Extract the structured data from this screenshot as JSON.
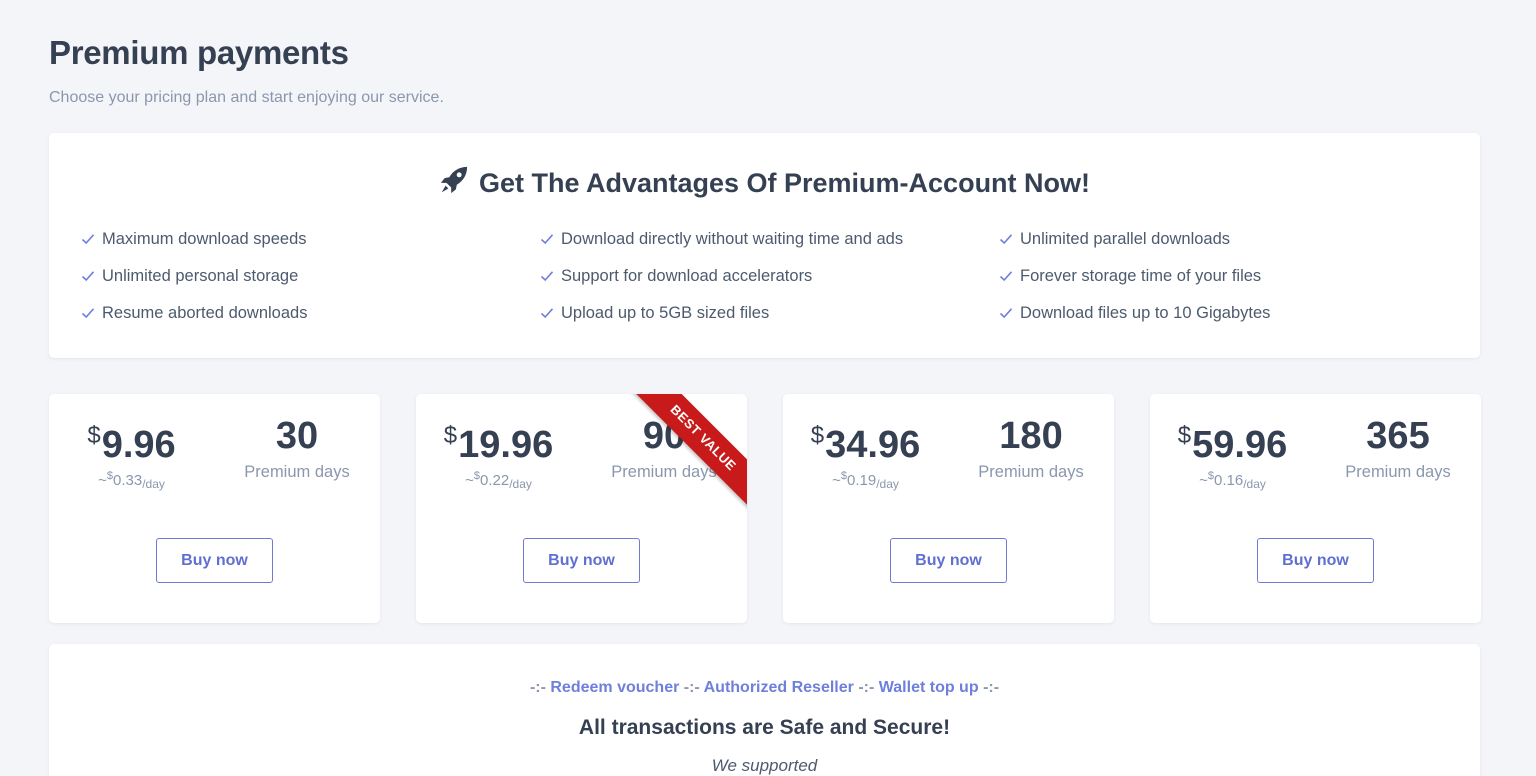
{
  "header": {
    "title": "Premium payments",
    "subtitle": "Choose your pricing plan and start enjoying our service."
  },
  "advantages": {
    "icon": "rocket-icon",
    "heading": "Get The Advantages Of Premium-Account Now!",
    "features": [
      "Maximum download speeds",
      "Download directly without waiting time and ads",
      "Unlimited parallel downloads",
      "Unlimited personal storage",
      "Support for download accelerators",
      "Forever storage time of your files",
      "Resume aborted downloads",
      "Upload up to 5GB sized files",
      "Download files up to 10 Gigabytes"
    ]
  },
  "plans": [
    {
      "currency": "$",
      "price": "9.96",
      "per_day_prefix": "~",
      "per_day": "0.33",
      "per_day_unit": "/day",
      "days": "30",
      "days_label": "Premium days",
      "button": "Buy now"
    },
    {
      "currency": "$",
      "price": "19.96",
      "per_day_prefix": "~",
      "per_day": "0.22",
      "per_day_unit": "/day",
      "days": "90",
      "days_label": "Premium days",
      "button": "Buy now",
      "ribbon": "BEST VALUE"
    },
    {
      "currency": "$",
      "price": "34.96",
      "per_day_prefix": "~",
      "per_day": "0.19",
      "per_day_unit": "/day",
      "days": "180",
      "days_label": "Premium days",
      "button": "Buy now"
    },
    {
      "currency": "$",
      "price": "59.96",
      "per_day_prefix": "~",
      "per_day": "0.16",
      "per_day_unit": "/day",
      "days": "365",
      "days_label": "Premium days",
      "button": "Buy now"
    }
  ],
  "footer": {
    "separator": "-:-",
    "links": [
      "Redeem voucher",
      "Authorized Reseller",
      "Wallet top up"
    ],
    "safe_text": "All transactions are Safe and Secure!",
    "supported_text": "We supported"
  },
  "colors": {
    "accent": "#6f7fdc",
    "ribbon": "#c81a1a",
    "text_dark": "#354052",
    "text_muted": "#8a97ad",
    "background": "#f4f5f9"
  }
}
